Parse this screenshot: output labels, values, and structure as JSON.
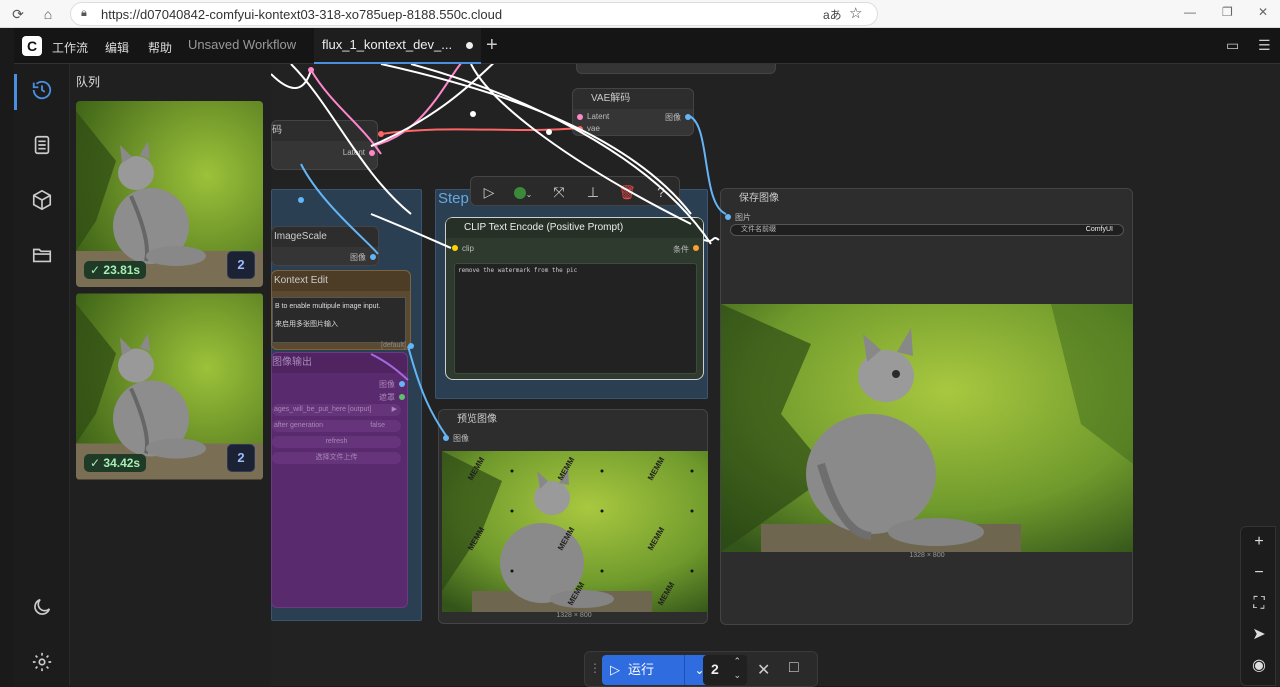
{
  "browser": {
    "url": "https://d07040842-comfyui-kontext03-318-xo785uep-8188.550c.cloud",
    "reader_label": "aあ"
  },
  "app": {
    "menus": [
      "工作流",
      "编辑",
      "帮助"
    ],
    "tabs": [
      {
        "label": "Unsaved Workflow",
        "active": false
      },
      {
        "label": "flux_1_kontext_dev_...",
        "active": true
      }
    ]
  },
  "sidebar": {
    "items": [
      "history-icon",
      "document-icon",
      "cube-icon",
      "folder-icon",
      "moon-icon",
      "gear-icon"
    ]
  },
  "queue": {
    "title": "队列",
    "items": [
      {
        "time": "23.81s",
        "count": "2"
      },
      {
        "time": "34.42s",
        "count": "2"
      }
    ]
  },
  "nodes": {
    "vae_decode": {
      "title": "VAE解码",
      "in1": "Latent",
      "in2": "vae",
      "out": "图像"
    },
    "top_partial": {
      "title": "码",
      "out": "Latent"
    },
    "imagescale": {
      "title": "ImageScale",
      "out": "图像"
    },
    "kontext_edit": {
      "title": "Kontext Edit",
      "line1": "B to enable multipule image input.",
      "line2": "来启用多张图片输入",
      "badge": "[default]"
    },
    "image_output": {
      "title": "图像输出",
      "ports": [
        "图像",
        "遮罩"
      ],
      "widgets": [
        "ages_will_be_put_here [output]",
        "after generation",
        "refresh",
        "选择文件上传"
      ],
      "widget_value": "false"
    },
    "group_label": "Step",
    "clip_encode": {
      "title": "CLIP Text Encode (Positive Prompt)",
      "in": "clip",
      "out": "条件",
      "text": "remove the watermark from the pic"
    },
    "save_image": {
      "title": "保存图像",
      "in": "图片",
      "widget_label": "文件名前缀",
      "widget_value": "ComfyUI",
      "dims": "1328 × 800"
    },
    "preview_image": {
      "title": "预览图像",
      "in": "图像",
      "dims": "1328 × 800",
      "watermark": "MEMM"
    }
  },
  "runbar": {
    "label": "运行",
    "count": "2"
  },
  "colors": {
    "accent": "#2f6ce0",
    "latent_wire": "#ff88cc",
    "vae_wire": "#ff6666",
    "image_wire": "#64b5f6",
    "clip_wire": "#ffd500"
  }
}
